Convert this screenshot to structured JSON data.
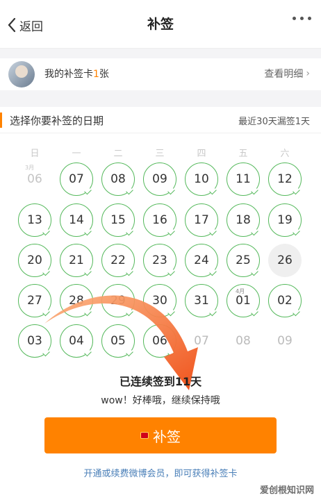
{
  "nav": {
    "back_label": "返回",
    "title": "补签",
    "more_icon": "more-dots-icon"
  },
  "card": {
    "label_prefix": "我的补签卡",
    "count": "1",
    "label_suffix": "张",
    "detail_label": "查看明细"
  },
  "section": {
    "title": "选择你要补签的日期",
    "note": "最近30天漏签1天"
  },
  "weekdays": [
    "日",
    "一",
    "二",
    "三",
    "四",
    "五",
    "六"
  ],
  "calendar": {
    "rows": [
      [
        {
          "day": "06",
          "state": "past",
          "month": "3月"
        },
        {
          "day": "07",
          "state": "done"
        },
        {
          "day": "08",
          "state": "done"
        },
        {
          "day": "09",
          "state": "done"
        },
        {
          "day": "10",
          "state": "done"
        },
        {
          "day": "11",
          "state": "done"
        },
        {
          "day": "12",
          "state": "done"
        }
      ],
      [
        {
          "day": "13",
          "state": "done"
        },
        {
          "day": "14",
          "state": "done"
        },
        {
          "day": "15",
          "state": "done"
        },
        {
          "day": "16",
          "state": "done"
        },
        {
          "day": "17",
          "state": "done"
        },
        {
          "day": "18",
          "state": "done"
        },
        {
          "day": "19",
          "state": "done"
        }
      ],
      [
        {
          "day": "20",
          "state": "done"
        },
        {
          "day": "21",
          "state": "done"
        },
        {
          "day": "22",
          "state": "done"
        },
        {
          "day": "23",
          "state": "done"
        },
        {
          "day": "24",
          "state": "done"
        },
        {
          "day": "25",
          "state": "done"
        },
        {
          "day": "26",
          "state": "today"
        }
      ],
      [
        {
          "day": "27",
          "state": "done"
        },
        {
          "day": "28",
          "state": "done"
        },
        {
          "day": "29",
          "state": "done"
        },
        {
          "day": "30",
          "state": "done"
        },
        {
          "day": "31",
          "state": "done"
        },
        {
          "day": "01",
          "state": "done",
          "month": "4月"
        },
        {
          "day": "02",
          "state": "done"
        }
      ],
      [
        {
          "day": "03",
          "state": "done"
        },
        {
          "day": "04",
          "state": "done"
        },
        {
          "day": "05",
          "state": "done"
        },
        {
          "day": "06",
          "state": "done"
        },
        {
          "day": "07",
          "state": "future"
        },
        {
          "day": "08",
          "state": "future"
        },
        {
          "day": "09",
          "state": "future"
        }
      ]
    ]
  },
  "summary": {
    "text": "已连续签到11天",
    "sub": "wow！好棒哦，继续保持哦"
  },
  "button": {
    "label": "补签"
  },
  "footer": {
    "link": "开通或续费微博会员，即可获得补签卡"
  },
  "watermark": "爱创根知识网",
  "colors": {
    "accent": "#ff8200",
    "check": "#53b85a",
    "link": "#4a7fb8"
  }
}
